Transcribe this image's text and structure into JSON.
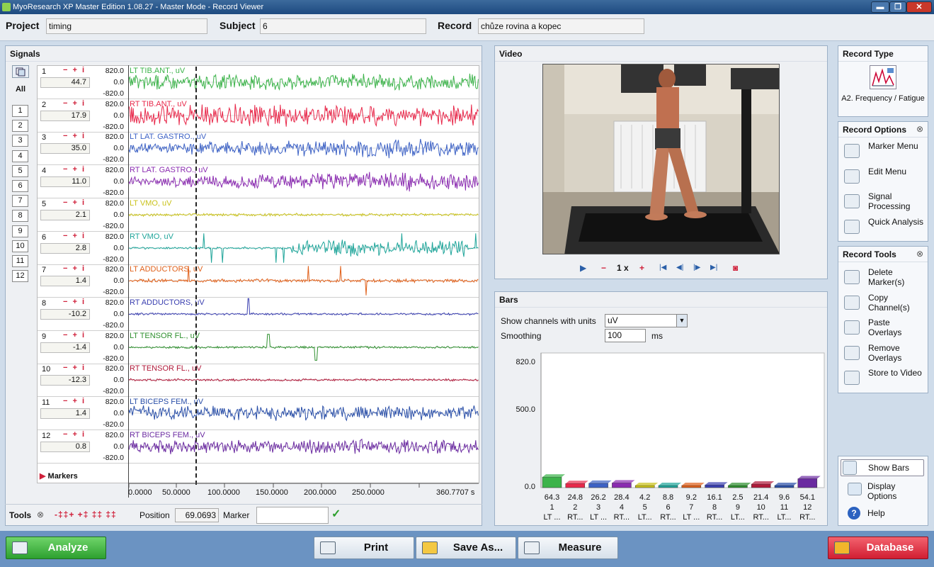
{
  "titlebar": {
    "title": "MyoResearch XP Master Edition 1.08.27 - Master Mode - Record Viewer",
    "minimize": "▬",
    "maximize": "❐",
    "close": "✕"
  },
  "top": {
    "project_label": "Project",
    "project_value": "timing",
    "subject_label": "Subject",
    "subject_value": "6",
    "record_label": "Record",
    "record_value": "chůze rovina a kopec"
  },
  "signals": {
    "title": "Signals",
    "all_label": "All",
    "channel_buttons": [
      "1",
      "2",
      "3",
      "4",
      "5",
      "6",
      "7",
      "8",
      "9",
      "10",
      "11",
      "12"
    ],
    "controls": "− + i",
    "channels": [
      {
        "num": "1",
        "value": "44.7",
        "max": "820.0",
        "mid": "0.0",
        "min": "-820.0",
        "name": "LT TIB.ANT., uV",
        "color": "#3cb34a",
        "amp": 0.55
      },
      {
        "num": "2",
        "value": "17.9",
        "max": "820.0",
        "mid": "0.0",
        "min": "-820.0",
        "name": "RT TIB.ANT., uV",
        "color": "#e8294b",
        "amp": 0.75
      },
      {
        "num": "3",
        "value": "35.0",
        "max": "820.0",
        "mid": "0.0",
        "min": "-820.0",
        "name": "LT LAT. GASTRO., uV",
        "color": "#3d62c5",
        "amp": 0.6
      },
      {
        "num": "4",
        "value": "11.0",
        "max": "820.0",
        "mid": "0.0",
        "min": "-820.0",
        "name": "RT LAT. GASTRO., uV",
        "color": "#8a2bb0",
        "amp": 0.6
      },
      {
        "num": "5",
        "value": "2.1",
        "max": "820.0",
        "mid": "0.0",
        "min": "-820.0",
        "name": "LT VMO, uV",
        "color": "#c9c21a",
        "amp": 0.1
      },
      {
        "num": "6",
        "value": "2.8",
        "max": "820.0",
        "mid": "0.0",
        "min": "-820.0",
        "name": "RT VMO, uV",
        "color": "#1fa59a",
        "amp": 0.25
      },
      {
        "num": "7",
        "value": "1.4",
        "max": "820.0",
        "mid": "0.0",
        "min": "-820.0",
        "name": "LT ADDUCTORS, uV",
        "color": "#e0601a",
        "amp": 0.12
      },
      {
        "num": "8",
        "value": "-10.2",
        "max": "820.0",
        "mid": "0.0",
        "min": "-820.0",
        "name": "RT ADDUCTORS, uV",
        "color": "#3a3fb0",
        "amp": 0.08
      },
      {
        "num": "9",
        "value": "-1.4",
        "max": "820.0",
        "mid": "0.0",
        "min": "-820.0",
        "name": "LT TENSOR FL., uV",
        "color": "#2e8f2e",
        "amp": 0.08
      },
      {
        "num": "10",
        "value": "-12.3",
        "max": "820.0",
        "mid": "0.0",
        "min": "-820.0",
        "name": "RT TENSOR FL., uV",
        "color": "#b01a3a",
        "amp": 0.08
      },
      {
        "num": "11",
        "value": "1.4",
        "max": "820.0",
        "mid": "0.0",
        "min": "-820.0",
        "name": "LT BICEPS FEM., uV",
        "color": "#2a4fa8",
        "amp": 0.5
      },
      {
        "num": "12",
        "value": "0.8",
        "max": "820.0",
        "mid": "0.0",
        "min": "-820.0",
        "name": "RT BICEPS FEM., uV",
        "color": "#6a2aa0",
        "amp": 0.5
      }
    ],
    "markers_label": "Markers",
    "time_axis": [
      "0.0000",
      "50.0000",
      "100.0000",
      "150.0000",
      "200.0000",
      "250.0000",
      "360.7707 s"
    ]
  },
  "tools": {
    "label": "Tools",
    "position_label": "Position",
    "position_value": "69.0693",
    "marker_label": "Marker",
    "marker_value": ""
  },
  "video": {
    "title": "Video",
    "speed": "1 x"
  },
  "bars": {
    "title": "Bars",
    "units_label": "Show channels with units",
    "units_value": "uV",
    "smoothing_label": "Smoothing",
    "smoothing_value": "100",
    "smoothing_unit": "ms",
    "y_ticks": [
      "820.0",
      "500.0",
      "0.0"
    ]
  },
  "chart_data": {
    "type": "bar",
    "categories": [
      "1",
      "2",
      "3",
      "4",
      "5",
      "6",
      "7",
      "8",
      "9",
      "10",
      "11",
      "12"
    ],
    "values": [
      64.3,
      24.8,
      26.2,
      28.4,
      4.2,
      8.8,
      9.2,
      16.1,
      2.5,
      21.4,
      9.6,
      54.1
    ],
    "short_labels": [
      "LT ...",
      "RT...",
      "LT ...",
      "RT...",
      "LT...",
      "RT...",
      "LT ...",
      "RT...",
      "LT...",
      "RT...",
      "LT...",
      "RT..."
    ],
    "colors": [
      "#3cb34a",
      "#e8294b",
      "#3d62c5",
      "#8a2bb0",
      "#c9c21a",
      "#1fa59a",
      "#e0601a",
      "#3a3fb0",
      "#2e8f2e",
      "#b01a3a",
      "#2a4fa8",
      "#6a2aa0"
    ],
    "ylim": [
      0,
      820
    ]
  },
  "record_type": {
    "title": "Record Type",
    "label": "A2. Frequency / Fatigue"
  },
  "record_options": {
    "title": "Record Options",
    "items": [
      "Marker Menu",
      "Edit Menu",
      "Signal Processing",
      "Quick Analysis"
    ]
  },
  "record_tools": {
    "title": "Record Tools",
    "items": [
      "Delete Marker(s)",
      "Copy Channel(s)",
      "Paste Overlays",
      "Remove Overlays",
      "Store to Video"
    ]
  },
  "side_bottom": {
    "show_bars": "Show Bars",
    "display_options": "Display Options",
    "help": "Help"
  },
  "bottom": {
    "analyze": "Analyze",
    "print": "Print",
    "save_as": "Save As...",
    "measure": "Measure",
    "database": "Database"
  }
}
